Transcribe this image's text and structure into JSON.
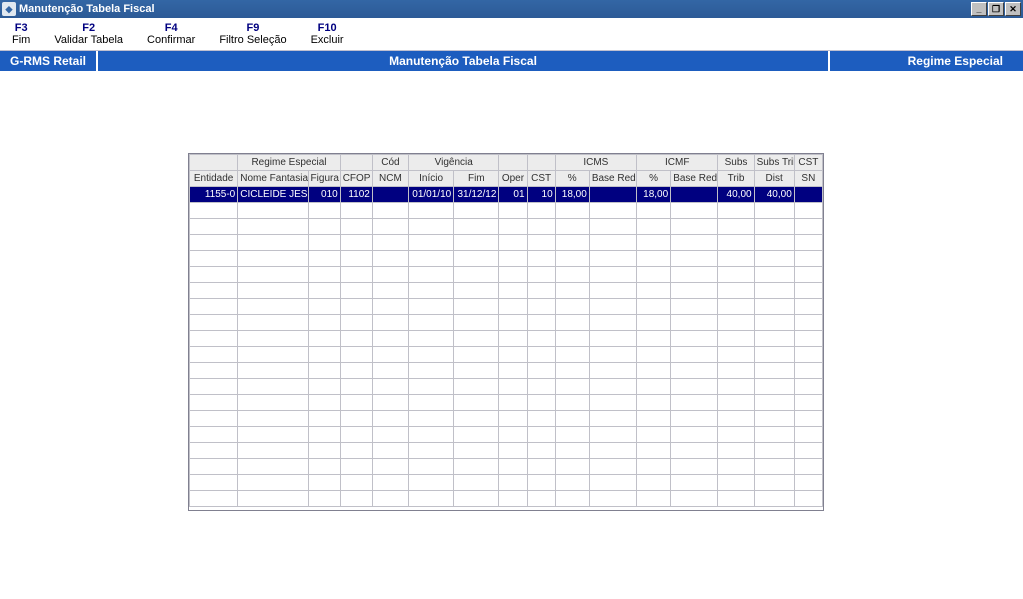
{
  "title": "Manutenção Tabela Fiscal",
  "toolbar": [
    {
      "key": "F3",
      "label": "Fim"
    },
    {
      "key": "F2",
      "label": "Validar Tabela"
    },
    {
      "key": "F4",
      "label": "Confirmar"
    },
    {
      "key": "F9",
      "label": "Filtro Seleção"
    },
    {
      "key": "F10",
      "label": "Excluir"
    }
  ],
  "bluebar": {
    "left": "G-RMS Retail",
    "center": "Manutenção Tabela Fiscal",
    "right": "Regime Especial"
  },
  "grid": {
    "group_headers": [
      {
        "label": "",
        "colspan": 1
      },
      {
        "label": "Regime Especial",
        "colspan": 2
      },
      {
        "label": "",
        "colspan": 1
      },
      {
        "label": "Cód",
        "colspan": 1
      },
      {
        "label": "Vigência",
        "colspan": 2
      },
      {
        "label": "",
        "colspan": 1
      },
      {
        "label": "",
        "colspan": 1
      },
      {
        "label": "ICMS",
        "colspan": 2
      },
      {
        "label": "ICMF",
        "colspan": 2
      },
      {
        "label": "Subs",
        "colspan": 1
      },
      {
        "label": "Subs Trib",
        "colspan": 1
      },
      {
        "label": "CST",
        "colspan": 1
      }
    ],
    "headers": [
      "Entidade",
      "Nome Fantasia",
      "Figura",
      "CFOP",
      "NCM",
      "Início",
      "Fim",
      "Oper",
      "CST",
      "%",
      "Base Red",
      "%",
      "Base Red",
      "Trib",
      "Dist",
      "SN"
    ],
    "widths": [
      48,
      70,
      32,
      32,
      36,
      45,
      45,
      28,
      28,
      34,
      47,
      34,
      47,
      36,
      40,
      28
    ],
    "rows": [
      {
        "cells": [
          "1155-0",
          "CICLEIDE JESUS N",
          "010",
          "1102",
          "",
          "01/01/10",
          "31/12/12",
          "01",
          "10",
          "18,00",
          "",
          "18,00",
          "",
          "40,00",
          "40,00",
          ""
        ]
      }
    ],
    "empty_rows": 19
  }
}
